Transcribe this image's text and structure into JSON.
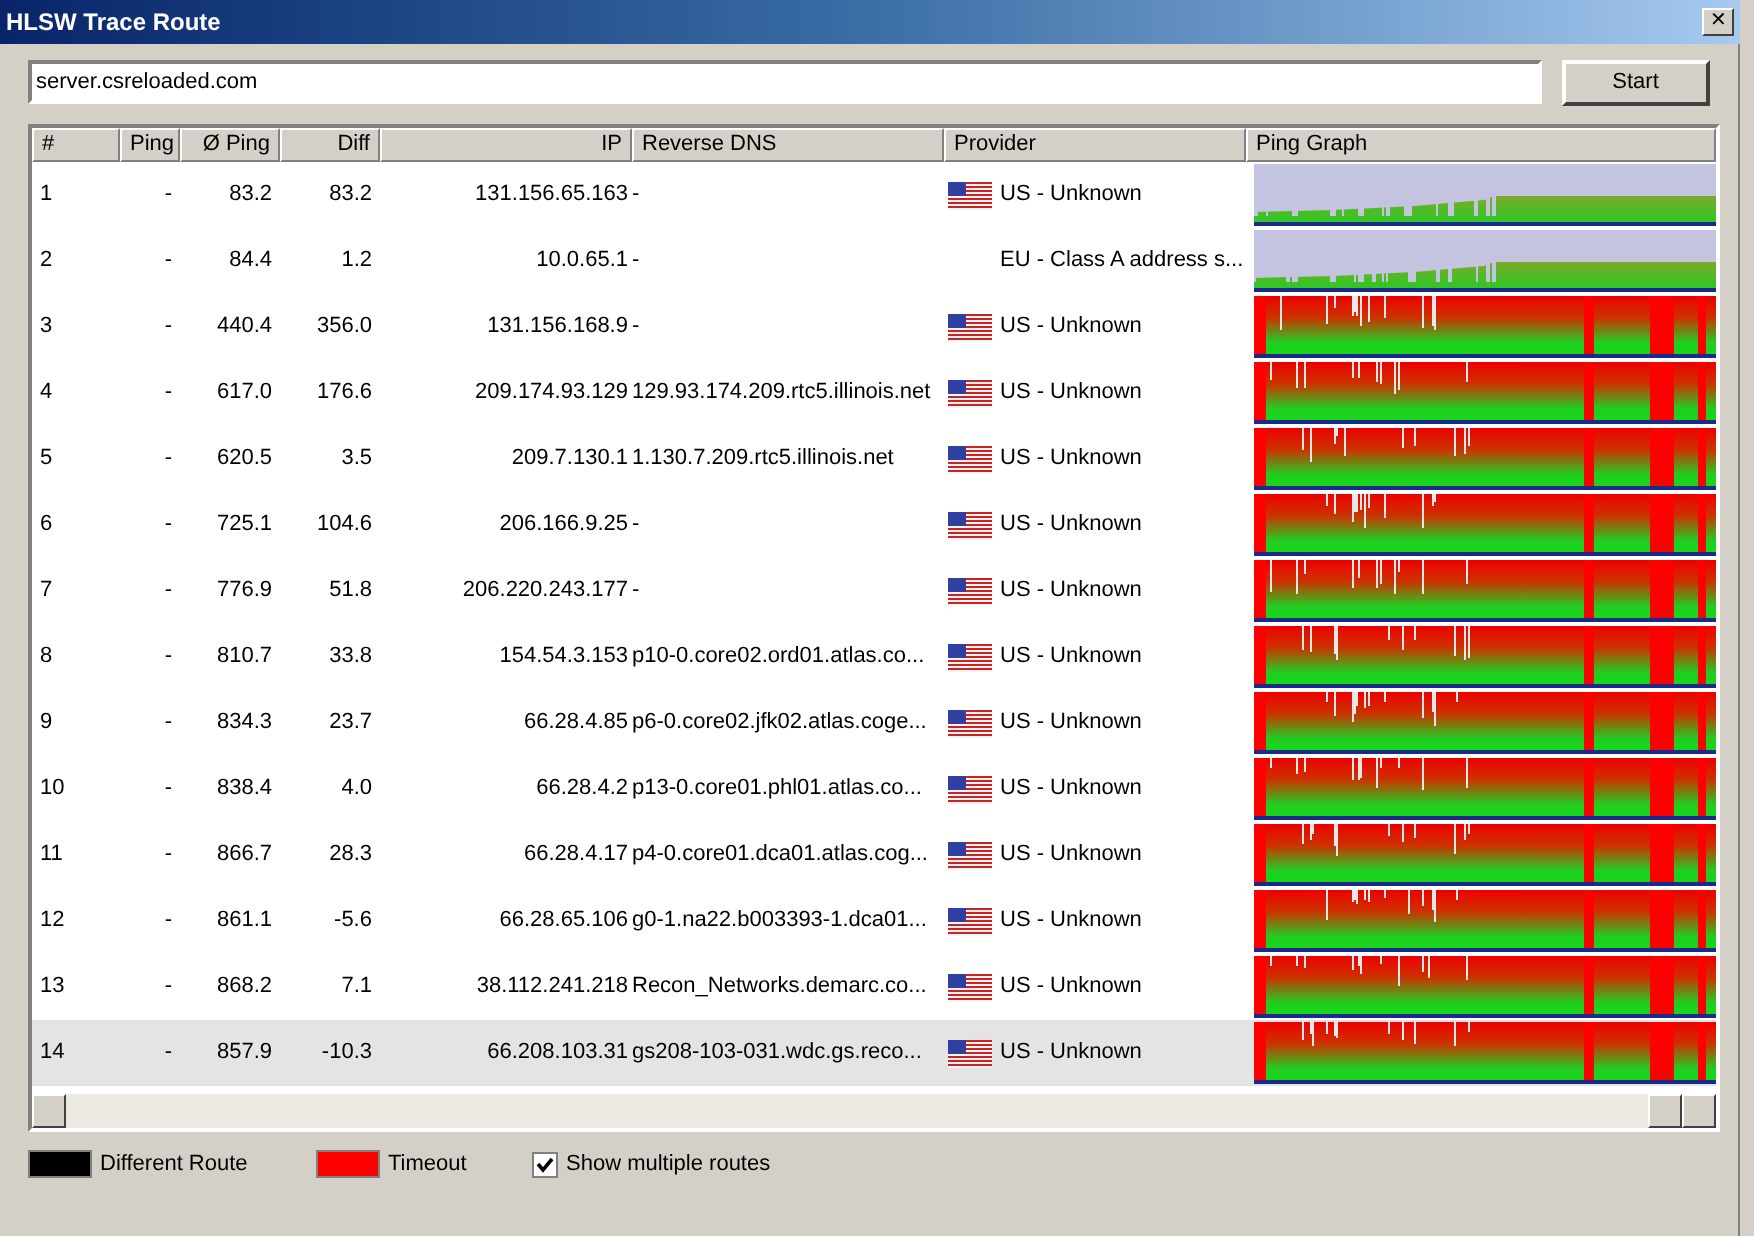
{
  "window": {
    "title": "HLSW Trace Route",
    "close": "✕"
  },
  "host_field": {
    "value": "server.csreloaded.com"
  },
  "start_button": "Start",
  "table": {
    "columns": [
      "#",
      "Ping",
      "Ø Ping",
      "Diff",
      "IP",
      "Reverse DNS",
      "Provider",
      "Ping Graph"
    ],
    "rows": [
      {
        "hop": "1",
        "ping": "-",
        "avg": "83.2",
        "diff": "83.2",
        "ip": "131.156.65.163",
        "dns": "-",
        "flag": true,
        "provider": "US - Unknown",
        "kind": "stable",
        "selected": false
      },
      {
        "hop": "2",
        "ping": "-",
        "avg": "84.4",
        "diff": "1.2",
        "ip": "10.0.65.1",
        "dns": "-",
        "flag": false,
        "provider": "EU - Class A address s...",
        "kind": "stable",
        "selected": false
      },
      {
        "hop": "3",
        "ping": "-",
        "avg": "440.4",
        "diff": "356.0",
        "ip": "131.156.168.9",
        "dns": "-",
        "flag": true,
        "provider": "US - Unknown",
        "kind": "timeouts",
        "selected": false
      },
      {
        "hop": "4",
        "ping": "-",
        "avg": "617.0",
        "diff": "176.6",
        "ip": "209.174.93.129",
        "dns": "129.93.174.209.rtc5.illinois.net",
        "flag": true,
        "provider": "US - Unknown",
        "kind": "timeouts",
        "selected": false
      },
      {
        "hop": "5",
        "ping": "-",
        "avg": "620.5",
        "diff": "3.5",
        "ip": "209.7.130.1",
        "dns": "1.130.7.209.rtc5.illinois.net",
        "flag": true,
        "provider": "US - Unknown",
        "kind": "timeouts",
        "selected": false
      },
      {
        "hop": "6",
        "ping": "-",
        "avg": "725.1",
        "diff": "104.6",
        "ip": "206.166.9.25",
        "dns": "-",
        "flag": true,
        "provider": "US - Unknown",
        "kind": "timeouts",
        "selected": false
      },
      {
        "hop": "7",
        "ping": "-",
        "avg": "776.9",
        "diff": "51.8",
        "ip": "206.220.243.177",
        "dns": "-",
        "flag": true,
        "provider": "US - Unknown",
        "kind": "timeouts",
        "selected": false
      },
      {
        "hop": "8",
        "ping": "-",
        "avg": "810.7",
        "diff": "33.8",
        "ip": "154.54.3.153",
        "dns": "p10-0.core02.ord01.atlas.co...",
        "flag": true,
        "provider": "US - Unknown",
        "kind": "timeouts",
        "selected": false
      },
      {
        "hop": "9",
        "ping": "-",
        "avg": "834.3",
        "diff": "23.7",
        "ip": "66.28.4.85",
        "dns": "p6-0.core02.jfk02.atlas.coge...",
        "flag": true,
        "provider": "US - Unknown",
        "kind": "timeouts",
        "selected": false
      },
      {
        "hop": "10",
        "ping": "-",
        "avg": "838.4",
        "diff": "4.0",
        "ip": "66.28.4.2",
        "dns": "p13-0.core01.phl01.atlas.co...",
        "flag": true,
        "provider": "US - Unknown",
        "kind": "timeouts",
        "selected": false
      },
      {
        "hop": "11",
        "ping": "-",
        "avg": "866.7",
        "diff": "28.3",
        "ip": "66.28.4.17",
        "dns": "p4-0.core01.dca01.atlas.cog...",
        "flag": true,
        "provider": "US - Unknown",
        "kind": "timeouts",
        "selected": false
      },
      {
        "hop": "12",
        "ping": "-",
        "avg": "861.1",
        "diff": "-5.6",
        "ip": "66.28.65.106",
        "dns": "g0-1.na22.b003393-1.dca01...",
        "flag": true,
        "provider": "US - Unknown",
        "kind": "timeouts",
        "selected": false
      },
      {
        "hop": "13",
        "ping": "-",
        "avg": "868.2",
        "diff": "7.1",
        "ip": "38.112.241.218",
        "dns": "Recon_Networks.demarc.co...",
        "flag": true,
        "provider": "US - Unknown",
        "kind": "timeouts",
        "selected": false
      },
      {
        "hop": "14",
        "ping": "-",
        "avg": "857.9",
        "diff": "-10.3",
        "ip": "66.208.103.31",
        "dns": "gs208-103-031.wdc.gs.reco...",
        "flag": true,
        "provider": "US - Unknown",
        "kind": "timeouts",
        "selected": true
      }
    ]
  },
  "legend": [
    {
      "label": "Different Route",
      "color": "#000000"
    },
    {
      "label": "Timeout",
      "color": "#ff0000"
    }
  ],
  "show_multiple_routes": {
    "label": "Show multiple routes",
    "checked": true
  }
}
